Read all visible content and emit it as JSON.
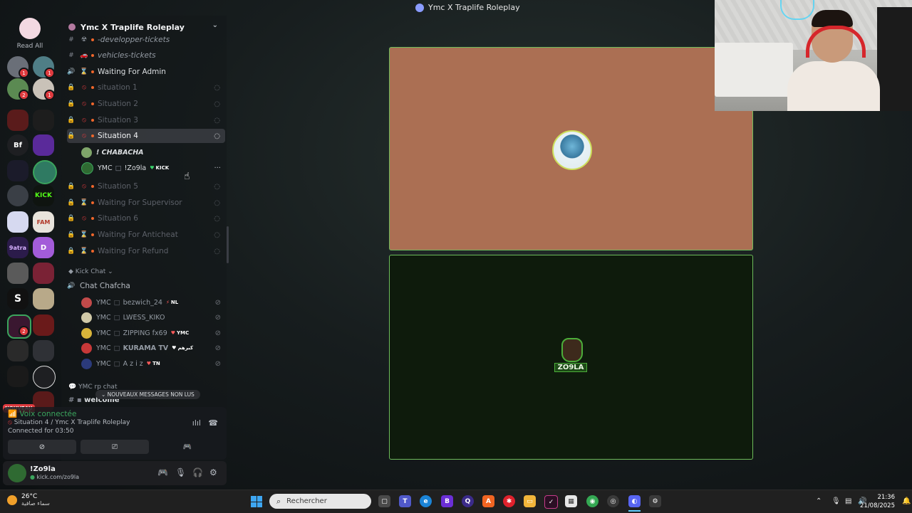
{
  "window": {
    "title": "Ymc X Traplife Roleplay"
  },
  "rail": {
    "read_all": "Read All",
    "servers": [
      {
        "label": "Bf"
      },
      {
        "label": "KICK"
      },
      {
        "label": "FAM"
      },
      {
        "label": "9atra"
      },
      {
        "label": "D"
      }
    ],
    "nouveau": "NOUVEAU"
  },
  "server": {
    "name": "Ymc X Traplife Roleplay",
    "channels": [
      {
        "name": "-developper-tickets"
      },
      {
        "name": "vehicles-tickets"
      },
      {
        "name": "Waiting For Admin"
      },
      {
        "name": "situation 1"
      },
      {
        "name": "Situation 2"
      },
      {
        "name": "Situation 3"
      },
      {
        "name": "Situation 4"
      },
      {
        "name": "Situation 5"
      },
      {
        "name": "Waiting For Supervisor"
      },
      {
        "name": "Situation 6"
      },
      {
        "name": "Waiting For Anticheat"
      },
      {
        "name": "Waiting For Refund"
      }
    ],
    "situation4_users": [
      {
        "name": "! CHABACHA"
      },
      {
        "tag": "YMC",
        "name": "!Zo9la",
        "badge": "KICK"
      }
    ],
    "kick_category": "Kick Chat",
    "chat_channel": "Chat Chafcha",
    "chat_users": [
      {
        "tag": "YMC",
        "name": "bezwich_24",
        "badge": "NL"
      },
      {
        "tag": "YMC",
        "name": "LWESS_KIKO",
        "badge": ""
      },
      {
        "tag": "YMC",
        "name": "ZIPPING fx69",
        "badge": "YMC"
      },
      {
        "tag": "YMC",
        "name": "KURAMA TV",
        "badge": "كبرهم"
      },
      {
        "tag": "YMC",
        "name": "A z i z",
        "badge": "TN"
      }
    ],
    "rp_category": "YMC rp chat",
    "welcome": "welcome",
    "new_messages": "NOUVEAUX MESSAGES NON LUS"
  },
  "voice": {
    "status": "Voix connectée",
    "location": "Situation 4 / Ymc X Traplife Roleplay",
    "duration": "Connected for 03:50"
  },
  "user": {
    "name": "!Zo9la",
    "status": "kick.com/zo9la"
  },
  "tiles": {
    "second_logo_text": "ZO9LA"
  },
  "taskbar": {
    "weather_temp": "26°C",
    "weather_desc": "سماء صافية",
    "search_placeholder": "Rechercher",
    "time": "21:36",
    "date": "21/08/2025"
  },
  "colors": {
    "tile1_bg": "#ab6f53",
    "tile2_bg": "#0e1b0c",
    "speaking_border": "#6dbb5a",
    "voice_green": "#3ba55d"
  }
}
